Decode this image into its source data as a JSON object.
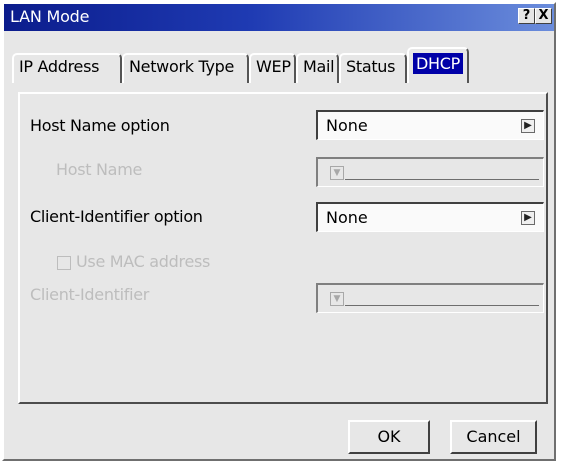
{
  "window": {
    "title": "LAN Mode",
    "help_label": "?",
    "close_label": "X"
  },
  "tabs": [
    {
      "label": "IP Address",
      "active": false
    },
    {
      "label": "Network Type",
      "active": false
    },
    {
      "label": "WEP",
      "active": false
    },
    {
      "label": "Mail",
      "active": false
    },
    {
      "label": "Status",
      "active": false
    },
    {
      "label": "DHCP",
      "active": true
    }
  ],
  "form": {
    "host_name_option_label": "Host Name option",
    "host_name_option_value": "None",
    "host_name_label": "Host Name",
    "host_name_value": "",
    "client_identifier_option_label": "Client-Identifier option",
    "client_identifier_option_value": "None",
    "use_mac_address_label": "Use MAC address",
    "use_mac_address_checked": false,
    "client_identifier_label": "Client-Identifier",
    "client_identifier_value": ""
  },
  "buttons": {
    "ok": "OK",
    "cancel": "Cancel"
  }
}
